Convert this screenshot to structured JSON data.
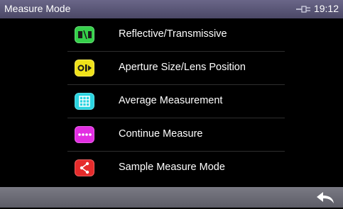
{
  "header": {
    "title": "Measure Mode",
    "time": "19:12",
    "connection_icon": "plug-icon"
  },
  "menu": {
    "items": [
      {
        "label": "Reflective/Transmissive",
        "icon": "reflective-transmissive-icon",
        "color": "#35d04a"
      },
      {
        "label": "Aperture Size/Lens Position",
        "icon": "aperture-lens-icon",
        "color": "#f0e21a"
      },
      {
        "label": "Average Measurement",
        "icon": "average-grid-icon",
        "color": "#2ad4e0"
      },
      {
        "label": "Continue Measure",
        "icon": "continue-dots-icon",
        "color": "#e22ee2"
      },
      {
        "label": "Sample Measure Mode",
        "icon": "sample-mode-icon",
        "color": "#e52b2b"
      }
    ]
  },
  "footer": {
    "back_icon": "back-arrow-icon"
  },
  "colors": {
    "titlebar": "#5a5677",
    "background": "#000000",
    "bottombar": "#6b6b74"
  }
}
